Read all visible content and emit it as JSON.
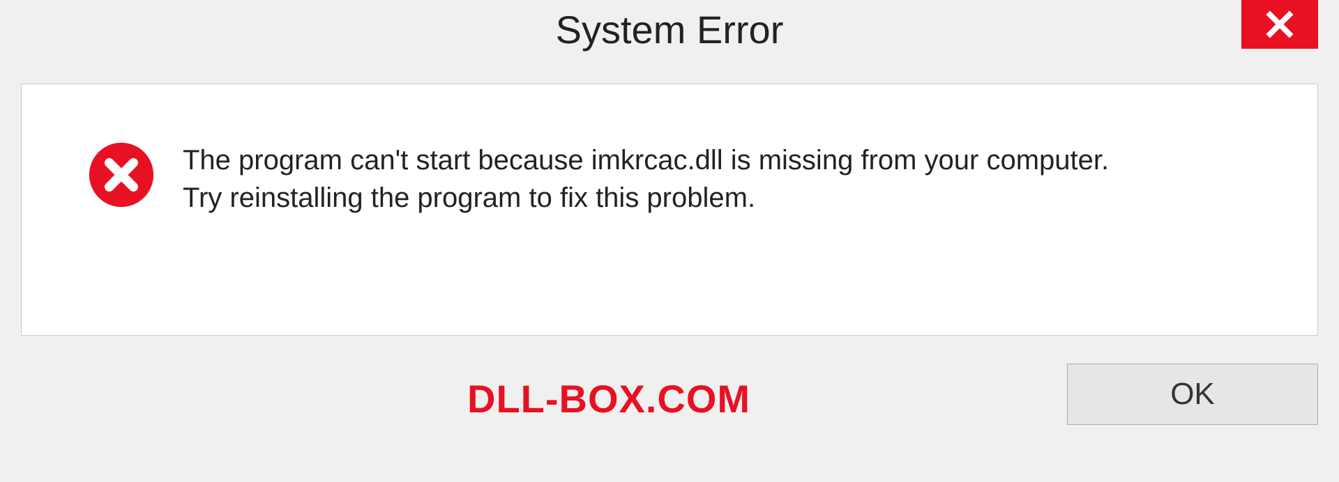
{
  "titlebar": {
    "title": "System Error"
  },
  "message": {
    "line1": "The program can't start because imkrcac.dll is missing from your computer.",
    "line2": "Try reinstalling the program to fix this problem."
  },
  "footer": {
    "watermark": "DLL-BOX.COM",
    "ok_label": "OK"
  }
}
